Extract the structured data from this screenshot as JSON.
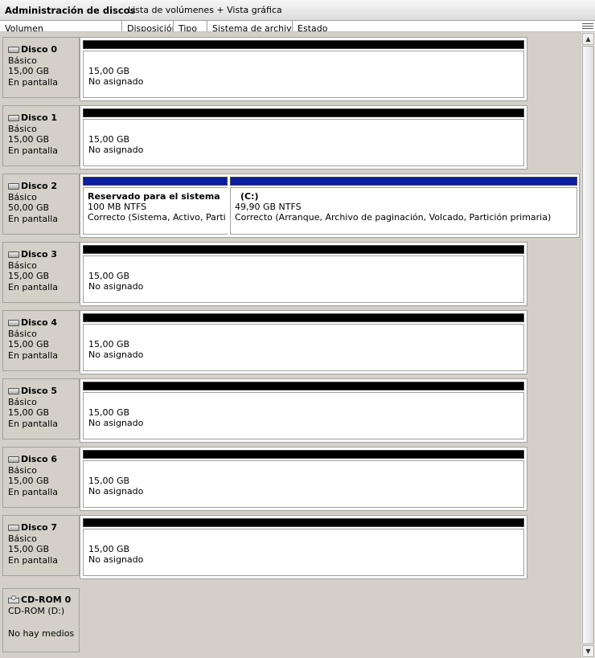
{
  "titlebar": {
    "title": "Administración de discos",
    "view": "Lista de volúmenes + Vista gráfica"
  },
  "columns": [
    "Volumen",
    "Disposición",
    "Tipo",
    "Sistema de archivos",
    "Estado"
  ],
  "disks": [
    {
      "name": "Disco 0",
      "type": "Básico",
      "size": "15,00 GB",
      "status": "En pantalla",
      "volumes": [
        {
          "size": "15,00 GB",
          "state": "No asignado"
        }
      ]
    },
    {
      "name": "Disco 1",
      "type": "Básico",
      "size": "15,00 GB",
      "status": "En pantalla",
      "volumes": [
        {
          "size": "15,00 GB",
          "state": "No asignado"
        }
      ]
    },
    {
      "name": "Disco 2",
      "type": "Básico",
      "size": "50,00 GB",
      "status": "En pantalla",
      "partitions": [
        {
          "name": "Reservado para el sistema",
          "fs": "100 MB NTFS",
          "health": "Correcto (Sistema, Activo, Partición primaria)"
        },
        {
          "name": "(C:)",
          "fs": "49,90 GB NTFS",
          "health": "Correcto (Arranque, Archivo de paginación, Volcado, Partición primaria)"
        }
      ]
    },
    {
      "name": "Disco 3",
      "type": "Básico",
      "size": "15,00 GB",
      "status": "En pantalla",
      "volumes": [
        {
          "size": "15,00 GB",
          "state": "No asignado"
        }
      ]
    },
    {
      "name": "Disco 4",
      "type": "Básico",
      "size": "15,00 GB",
      "status": "En pantalla",
      "volumes": [
        {
          "size": "15,00 GB",
          "state": "No asignado"
        }
      ]
    },
    {
      "name": "Disco 5",
      "type": "Básico",
      "size": "15,00 GB",
      "status": "En pantalla",
      "volumes": [
        {
          "size": "15,00 GB",
          "state": "No asignado"
        }
      ]
    },
    {
      "name": "Disco 6",
      "type": "Básico",
      "size": "15,00 GB",
      "status": "En pantalla",
      "volumes": [
        {
          "size": "15,00 GB",
          "state": "No asignado"
        }
      ]
    },
    {
      "name": "Disco 7",
      "type": "Básico",
      "size": "15,00 GB",
      "status": "En pantalla",
      "volumes": [
        {
          "size": "15,00 GB",
          "state": "No asignado"
        }
      ]
    }
  ],
  "cdrom": {
    "name": "CD-ROM 0",
    "drive": "CD-ROM (D:)",
    "media": "No hay medios"
  },
  "colors": {
    "unallocated_bar": "#000000",
    "primary_bar": "#0a1ea0"
  },
  "icons": {
    "disk": "disk-drive-icon",
    "cdrom": "cd-drive-icon"
  }
}
